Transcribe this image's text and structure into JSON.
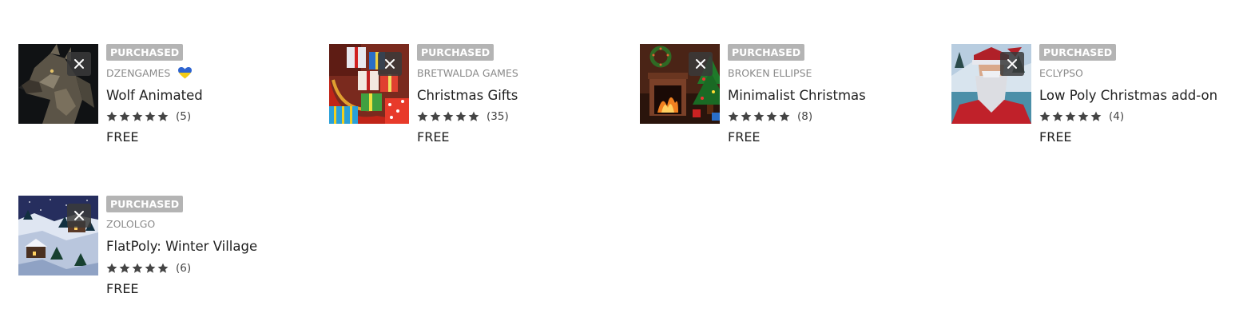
{
  "assets": [
    {
      "badge": "PURCHASED",
      "publisher": "DZENGAMES",
      "publisher_flag": "ukraine-heart",
      "title": "Wolf Animated",
      "rating_count": "(5)",
      "stars": 5,
      "price": "FREE",
      "thumbnail": "wolf"
    },
    {
      "badge": "PURCHASED",
      "publisher": "BRETWALDA GAMES",
      "title": "Christmas Gifts",
      "rating_count": "(35)",
      "stars": 5,
      "price": "FREE",
      "thumbnail": "gifts-sleigh"
    },
    {
      "badge": "PURCHASED",
      "publisher": "BROKEN ELLIPSE",
      "title": "Minimalist Christmas",
      "rating_count": "(8)",
      "stars": 5,
      "price": "FREE",
      "thumbnail": "fireplace"
    },
    {
      "badge": "PURCHASED",
      "publisher": "ECLYPSO",
      "title": "Low Poly Christmas add-on",
      "rating_count": "(4)",
      "stars": 5,
      "price": "FREE",
      "thumbnail": "low-poly-santa"
    },
    {
      "badge": "PURCHASED",
      "publisher": "ZOLOLGO",
      "title": "FlatPoly: Winter Village",
      "rating_count": "(6)",
      "stars": 5,
      "price": "FREE",
      "thumbnail": "winter-village"
    }
  ],
  "colors": {
    "badge_bg": "#b4b4b4",
    "star": "#444444",
    "publisher": "#8a8a8a"
  }
}
